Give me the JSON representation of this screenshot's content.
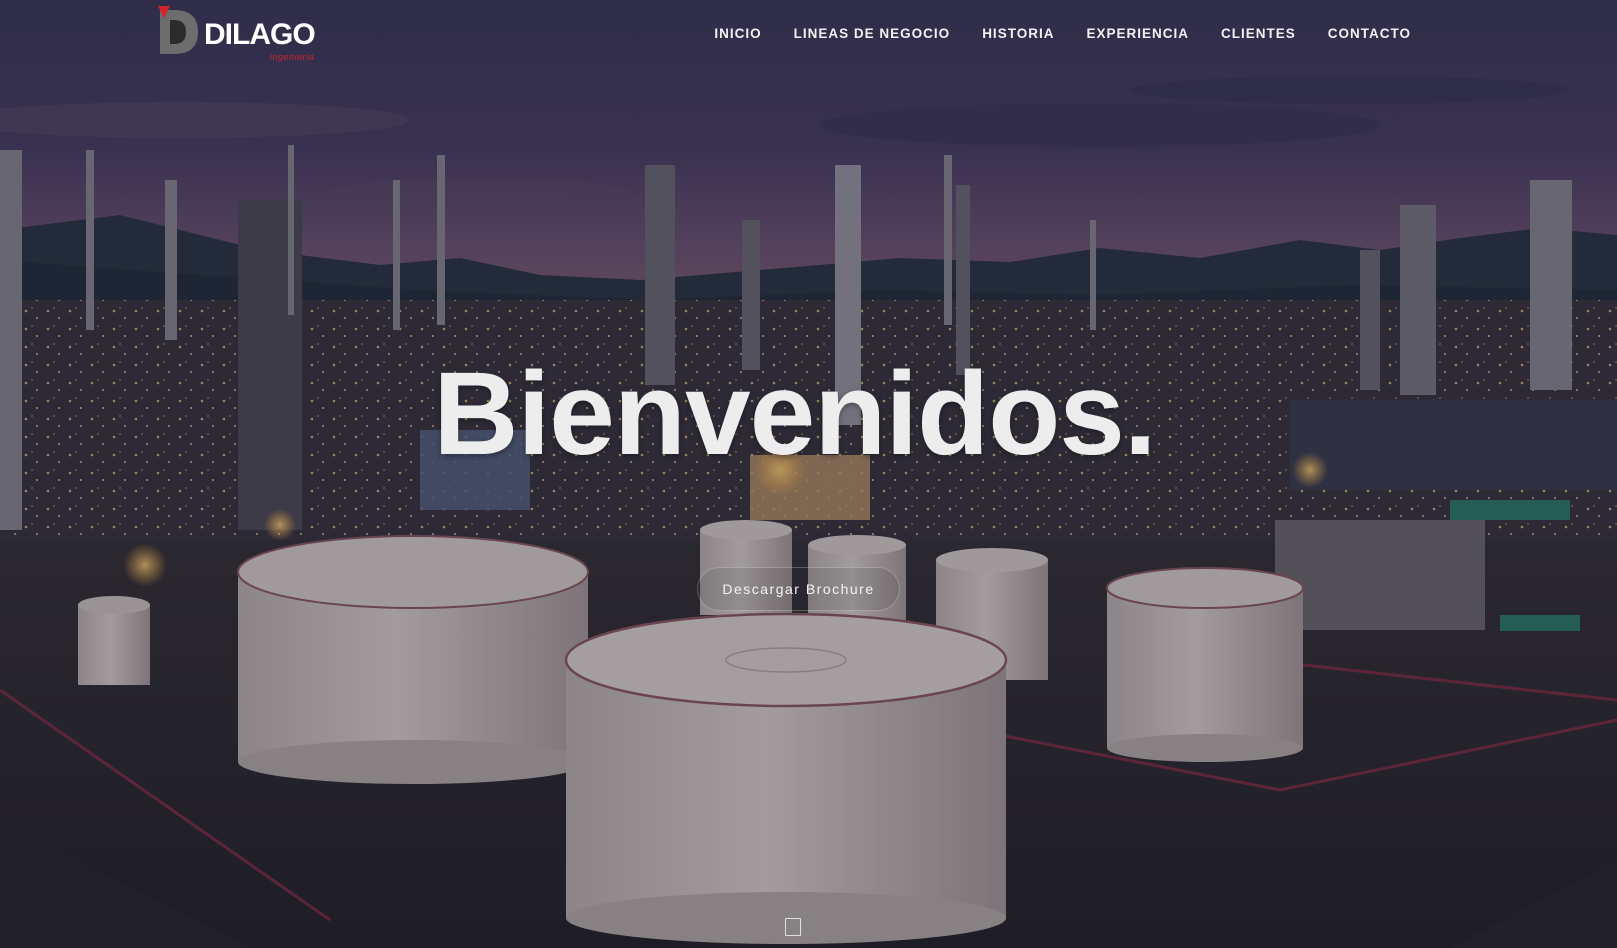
{
  "header": {
    "logo_text": "DILAGO",
    "logo_tagline": "ingeniería",
    "nav": [
      {
        "label": "INICIO"
      },
      {
        "label": "LINEAS DE NEGOCIO"
      },
      {
        "label": "HISTORIA"
      },
      {
        "label": "EXPERIENCIA"
      },
      {
        "label": "CLIENTES"
      },
      {
        "label": "CONTACTO"
      }
    ]
  },
  "hero": {
    "title": "Bienvenidos.",
    "cta_label": "Descargar Brochure",
    "background": "industrial-refinery-storage-tanks-at-dusk"
  },
  "colors": {
    "brand_red": "#d2232a",
    "text_light": "#ededed",
    "sky_top": "#4a3f66",
    "sky_horizon": "#7a5d7a"
  },
  "icons": {
    "logo_mark": "dilago-d-logo-icon",
    "scroll": "scroll-down-icon"
  }
}
